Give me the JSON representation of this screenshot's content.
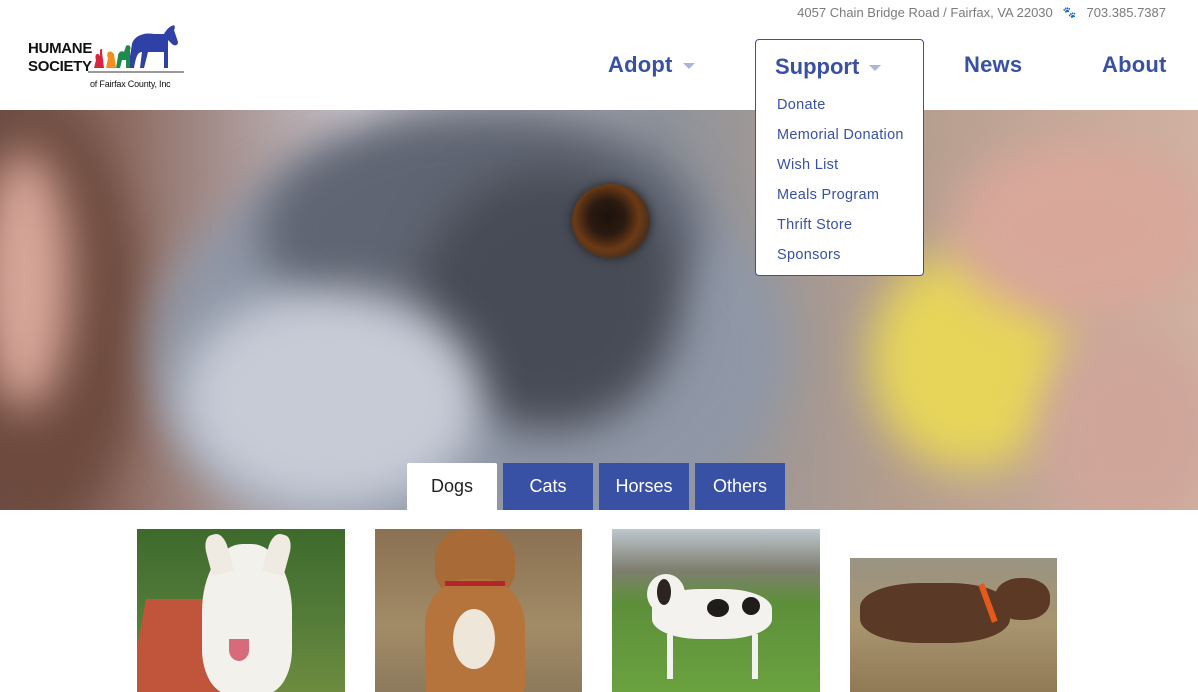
{
  "logo": {
    "line1": "HUMANE",
    "line2": "SOCIETY",
    "line3": "of Fairfax County, Inc"
  },
  "topbar": {
    "address": "4057 Chain Bridge Road / Fairfax, VA 22030",
    "phone": "703.385.7387",
    "separator_icon": "paw-icon"
  },
  "nav": {
    "adopt": "Adopt",
    "support": "Support",
    "news": "News",
    "about": "About"
  },
  "support_menu": [
    "Donate",
    "Memorial Donation",
    "Wish List",
    "Meals Program",
    "Thrift Store",
    "Sponsors"
  ],
  "tabs": [
    "Dogs",
    "Cats",
    "Horses",
    "Others"
  ],
  "active_tab": "Dogs",
  "colors": {
    "brand_blue": "#3951a5",
    "address_gray": "#7b7b7b",
    "caret": "#a9b5d9"
  }
}
